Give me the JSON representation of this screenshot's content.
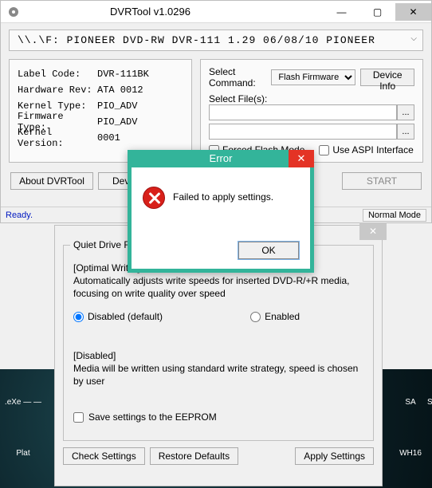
{
  "window": {
    "title": "DVRTool v1.0296",
    "device_line": "\\\\.\\F: PIONEER  DVD-RW  DVR-111  1.29  06/08/10  PIONEER"
  },
  "info": {
    "rows": [
      {
        "label": "Label Code:",
        "value": "DVR-111BK"
      },
      {
        "label": "Hardware Rev:",
        "value": "ATA 0012"
      },
      {
        "label": "Kernel Type:",
        "value": "PIO_ADV"
      },
      {
        "label": "Firmware Type:",
        "value": "PIO_ADV"
      },
      {
        "label": "Kernel Version:",
        "value": "0001"
      }
    ]
  },
  "right": {
    "select_command_label": "Select Command:",
    "command_value": "Flash Firmware",
    "device_info_btn": "Device Info",
    "select_files_label": "Select File(s):",
    "browse_btn": "...",
    "forced_flash": "Forced Flash Mode",
    "aspi": "Use ASPI Interface"
  },
  "bottom": {
    "about": "About DVRTool",
    "devi": "Devi",
    "start": "START"
  },
  "status": {
    "ready": "Ready.",
    "mode": "Normal Mode"
  },
  "quiet": {
    "group_title": "Quiet Drive Fea",
    "heading": "[Optimal Writing",
    "desc": "Automatically adjusts write speeds for inserted DVD-R/+R media, focusing on write quality over speed",
    "radio_disabled": "Disabled (default)",
    "radio_enabled": "Enabled",
    "heading2": "[Disabled]",
    "desc2": "Media will be written using standard write strategy, speed is chosen by user",
    "save_eeprom": "Save settings to the EEPROM",
    "check": "Check Settings",
    "restore": "Restore Defaults",
    "apply": "Apply Settings"
  },
  "error": {
    "title": "Error",
    "msg": "Failed to apply settings.",
    "ok": "OK"
  },
  "desktop": {
    "i1": ".eXe —\n—",
    "i2": "Plat",
    "i3": "SA",
    "i4": "SH",
    "i5": "WH16"
  }
}
